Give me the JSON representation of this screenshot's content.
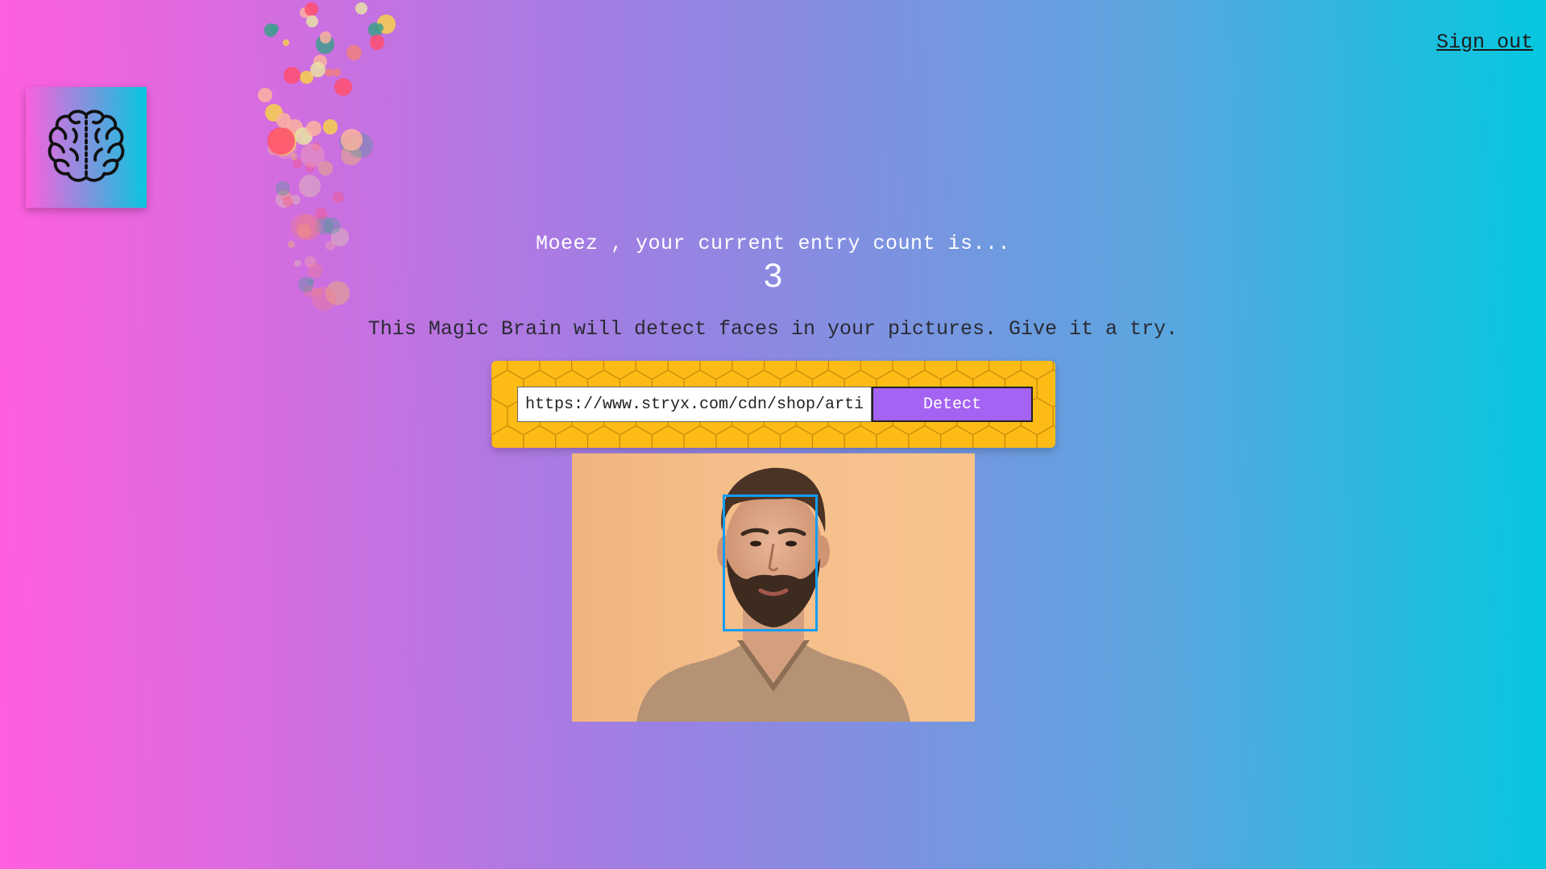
{
  "header": {
    "logo_icon": "brain-icon",
    "sign_out_label": "Sign out"
  },
  "rank": {
    "message": "Moeez , your current entry count is...",
    "count": "3"
  },
  "intro": {
    "text": "This Magic Brain will detect faces in your pictures. Give it a try."
  },
  "form": {
    "url_value": "https://www.stryx.com/cdn/shop/articles/man-looking-attractive.jpg",
    "detect_label": "Detect"
  },
  "result": {
    "image_icon": "portrait-photo",
    "faces_detected": 1
  },
  "colors": {
    "gradient_left": "#ff5edf",
    "gradient_right": "#04c8de",
    "panel_yellow": "#fdbb16",
    "button_purple": "#a463f2",
    "face_box_blue": "#149df2"
  }
}
